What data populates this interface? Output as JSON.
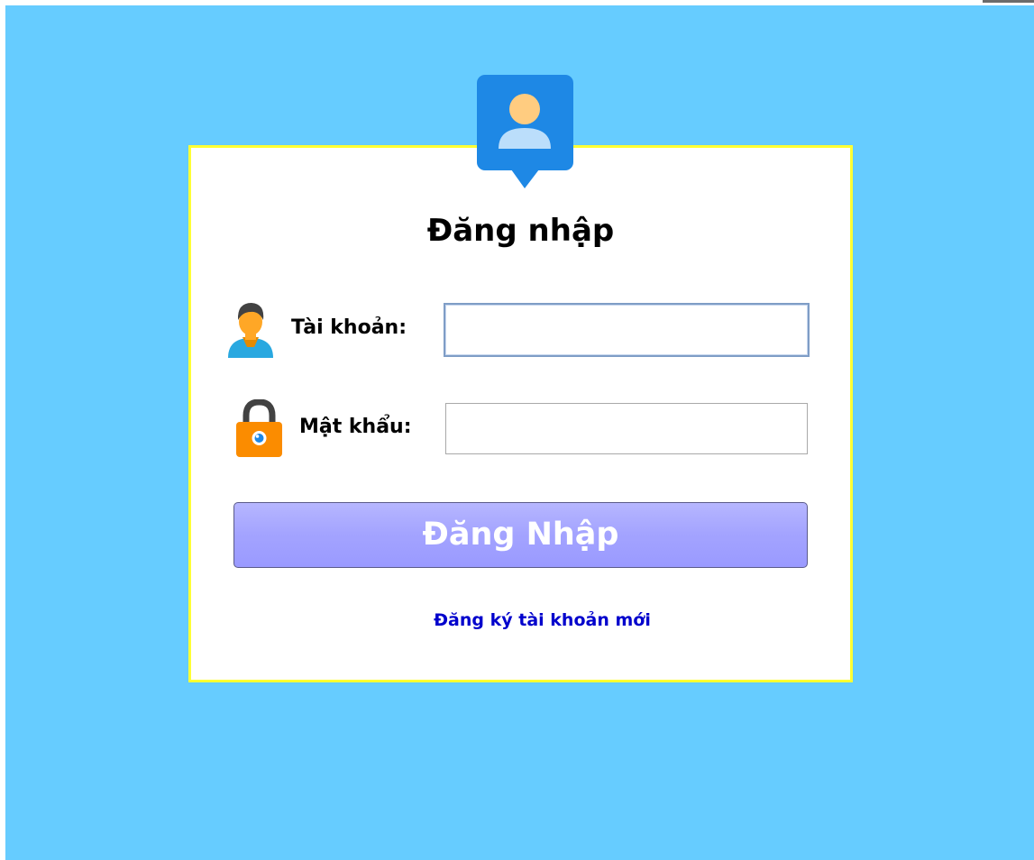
{
  "login": {
    "title": "Đăng nhập",
    "username_label": "Tài khoản:",
    "username_value": "",
    "password_label": "Mật khẩu:",
    "password_value": "",
    "submit_label": "Đăng Nhập",
    "register_link": "Đăng ký tài khoản mới"
  },
  "icons": {
    "header": "user-avatar-icon",
    "username": "user-icon",
    "password": "lock-icon"
  },
  "colors": {
    "background": "#66ccff",
    "card_border": "#ffff33",
    "button": "#a3a3ff",
    "link": "#0000cc",
    "avatar_badge": "#1e88e5"
  }
}
